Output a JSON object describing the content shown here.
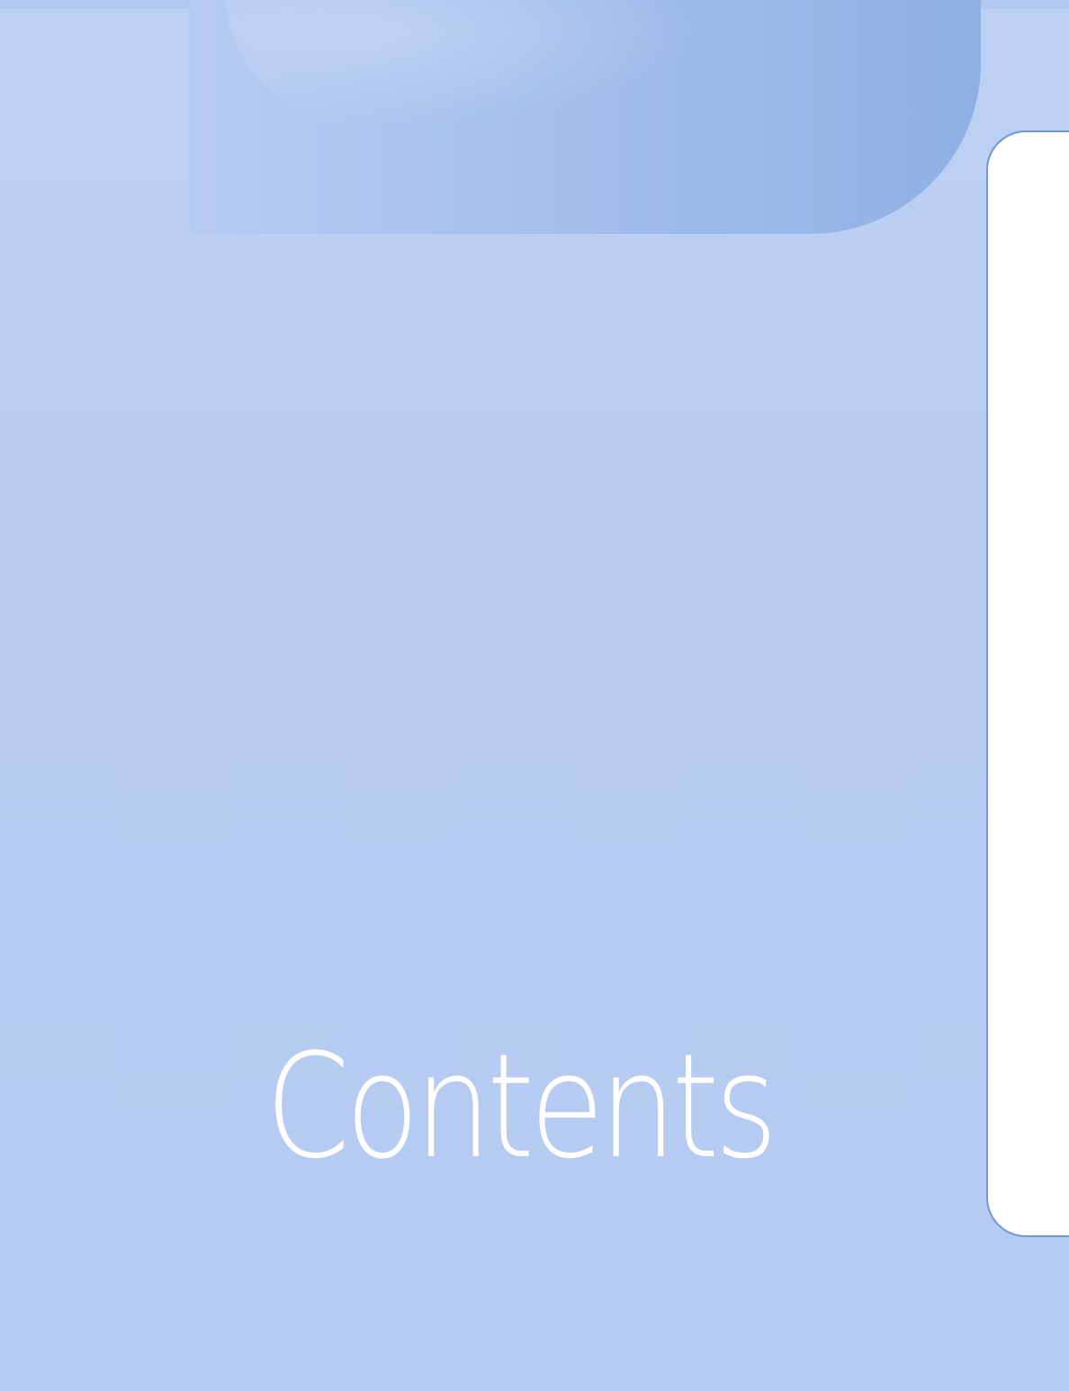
{
  "page": {
    "title": "Contents"
  },
  "colors": {
    "background": "#b9cdf3",
    "header_shape_light": "#b7cbf2",
    "header_shape_dark": "#8fb0e3",
    "side_tab_border": "#6f97d6",
    "side_tab_fill": "#ffffff",
    "title_text": "#ffffff"
  }
}
